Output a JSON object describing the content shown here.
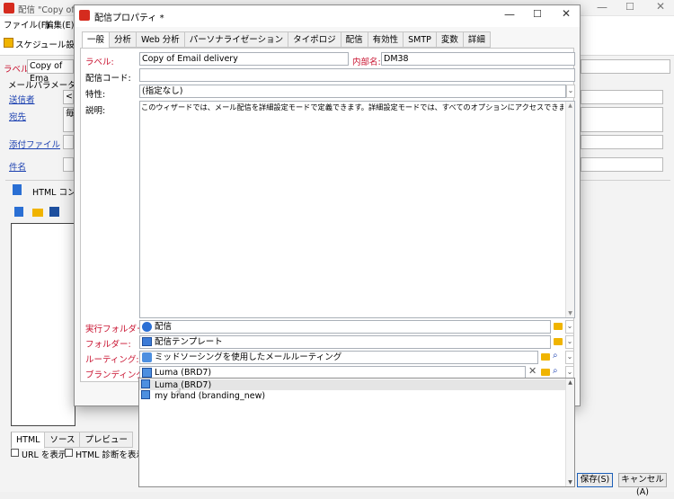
{
  "bg_window": {
    "title": "配信 \"Copy of Ema",
    "menu": [
      "ファイル(F)",
      "編集(E)"
    ],
    "toolbar_label": "スケジュール設定",
    "label_label": "ラベル:",
    "label_value": "Copy of Ema",
    "mail_params": "メールパラメーター",
    "sender": "送信者",
    "sender_value": "<",
    "recipient": "宛先",
    "recipient_value": "毎",
    "attachments": "添付ファイル",
    "subject": "件名",
    "html_content": "HTML コンテ",
    "bottom_tabs": [
      "HTML",
      "ソース",
      "プレビュー"
    ],
    "check_url": "URL を表示",
    "check_html_diag": "HTML 診断を表示",
    "save_button": "保存(S)",
    "cancel_button": "キャンセル(A)"
  },
  "dialog": {
    "title": "配信プロパティ *",
    "tabs": [
      "一般",
      "分析",
      "Web 分析",
      "パーソナライゼーション",
      "タイポロジ",
      "配信",
      "有効性",
      "SMTP",
      "変数",
      "詳細"
    ],
    "label_label": "ラベル:",
    "label_value": "Copy of Email delivery",
    "internal_name_label": "内部名:",
    "internal_name_value": "DM38",
    "delivery_code_label": "配信コード:",
    "delivery_code_value": "",
    "nature_label": "特性:",
    "nature_value": "(指定なし)",
    "description_label": "説明:",
    "description_value": "このウィザードでは、メール配信を詳細設定モードで定義できます。詳細設定モードでは、すべてのオプションにアクセスできます。",
    "exec_folder_label": "実行フォルダー:",
    "exec_folder_value": "配信",
    "folder_label": "フォルダー:",
    "folder_value": "配信テンプレート",
    "routing_label": "ルーティング:",
    "routing_value": "ミッドソーシングを使用したメールルーティング",
    "branding_label": "ブランディング:",
    "branding_value": "Luma (BRD7)"
  },
  "dropdown": {
    "items": [
      "Luma (BRD7)",
      "my brand (branding_new)"
    ]
  },
  "colors": {
    "accent_red": "#c8102e",
    "link_blue": "#1a3fb0",
    "folder_yellow": "#f0b400"
  }
}
